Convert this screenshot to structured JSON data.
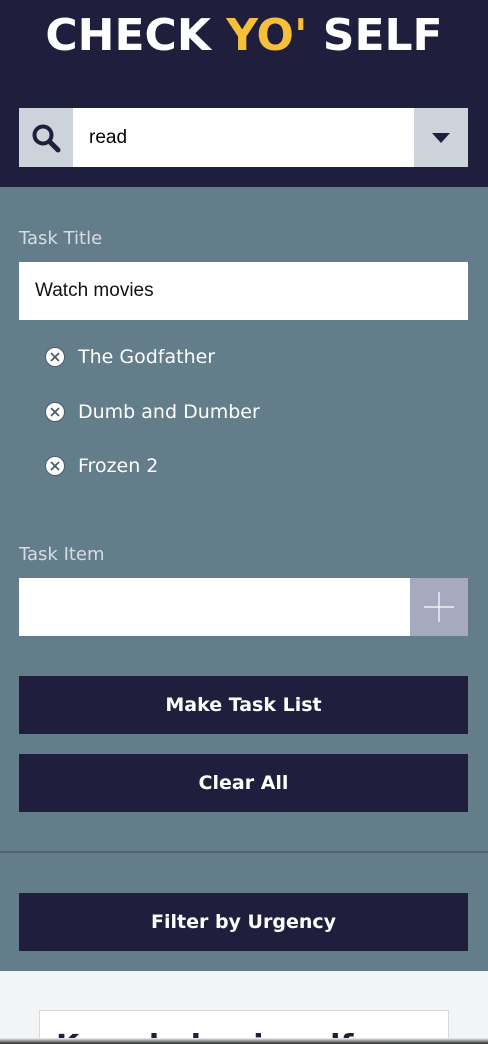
{
  "header": {
    "logo_part1": "CHECK ",
    "logo_accent": "YO'",
    "logo_part3": " SELF",
    "accent_color": "#f5bf3a",
    "background_color": "#1f1f3d"
  },
  "search": {
    "value": "read",
    "icon": "magnifying-glass-icon",
    "dropdown_icon": "caret-down-icon"
  },
  "form": {
    "task_title_label": "Task Title",
    "task_title_value": "Watch movies",
    "items": [
      {
        "label": "The Godfather",
        "icon": "remove-circle-icon"
      },
      {
        "label": "Dumb and Dumber",
        "icon": "remove-circle-icon"
      },
      {
        "label": "Frozen 2",
        "icon": "remove-circle-icon"
      }
    ],
    "task_item_label": "Task Item",
    "task_item_value": "",
    "add_icon": "plus-icon",
    "make_list_button": "Make Task List",
    "clear_all_button": "Clear All"
  },
  "filter": {
    "button": "Filter by Urgency"
  },
  "card": {
    "title": "Knowledge is self"
  }
}
